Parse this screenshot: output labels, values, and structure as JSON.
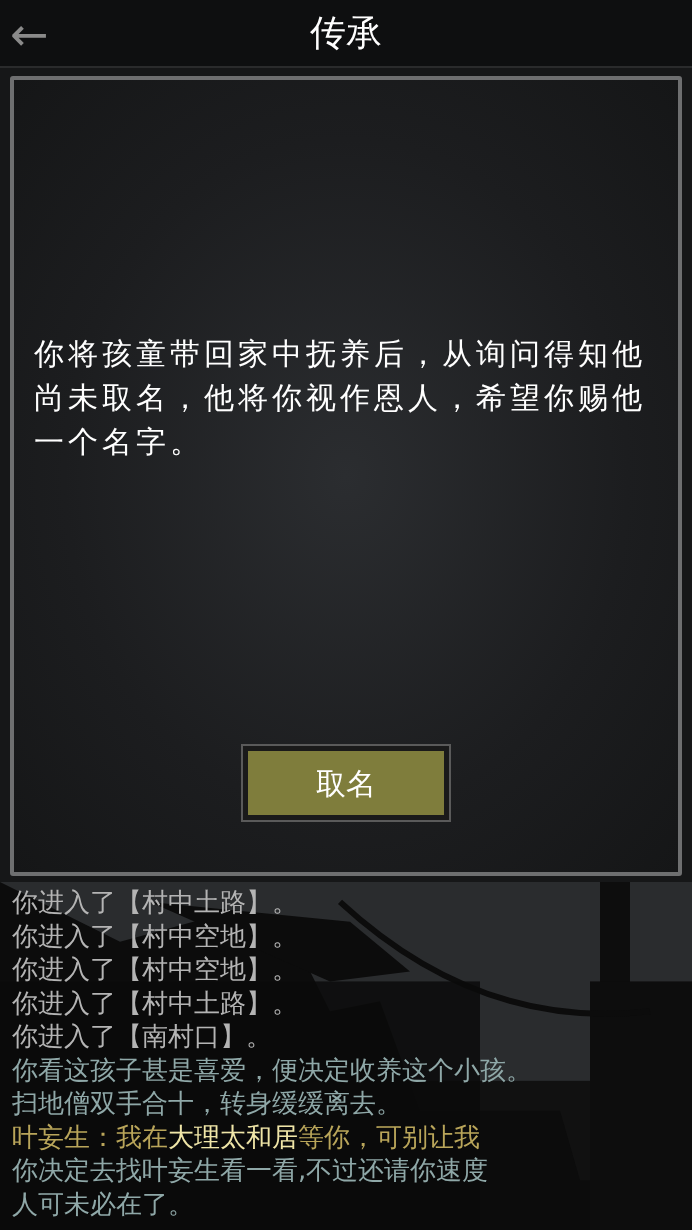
{
  "header": {
    "title": "传承",
    "back_icon": "←"
  },
  "dialog": {
    "message": "你将孩童带回家中抚养后，从询问得知他尚未取名，他将你视作恩人，希望你赐他一个名字。",
    "button": "取名"
  },
  "log": [
    {
      "kind": "system",
      "parts": [
        {
          "text": "你进入了【村中土路】。",
          "highlight": false
        }
      ]
    },
    {
      "kind": "system",
      "parts": [
        {
          "text": "你进入了【村中空地】。",
          "highlight": false
        }
      ]
    },
    {
      "kind": "system",
      "parts": [
        {
          "text": "你进入了【村中空地】。",
          "highlight": false
        }
      ]
    },
    {
      "kind": "system",
      "parts": [
        {
          "text": "你进入了【村中土路】。",
          "highlight": false
        }
      ]
    },
    {
      "kind": "system",
      "parts": [
        {
          "text": "你进入了【南村口】。",
          "highlight": false
        }
      ]
    },
    {
      "kind": "narration",
      "parts": [
        {
          "text": "你看这孩子甚是喜爱，便决定收养这个小孩。",
          "highlight": false
        }
      ]
    },
    {
      "kind": "narration",
      "parts": [
        {
          "text": "扫地僧双手合十，转身缓缓离去。",
          "highlight": false
        }
      ]
    },
    {
      "kind": "dialogue",
      "parts": [
        {
          "text": "叶妄生：我在",
          "highlight": false
        },
        {
          "text": "大理太和居",
          "highlight": true
        },
        {
          "text": "等你，可别让我",
          "highlight": false
        }
      ]
    },
    {
      "kind": "narration",
      "parts": [
        {
          "text": "你决定去找叶妄生看一看,不过还请你速度",
          "highlight": false
        }
      ]
    },
    {
      "kind": "narration",
      "parts": [
        {
          "text": "人可未必在了。",
          "highlight": false
        }
      ]
    }
  ]
}
